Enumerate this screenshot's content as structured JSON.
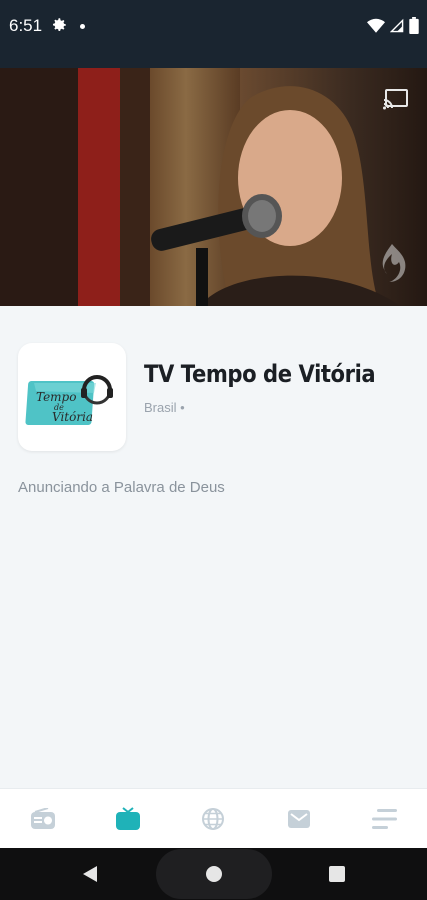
{
  "status_bar": {
    "time": "6:51",
    "icons": [
      "gear-icon",
      "notification-dot-icon",
      "wifi-icon",
      "signal-icon",
      "battery-icon"
    ]
  },
  "video": {
    "cast_icon": "cast-icon",
    "watermark_icon": "flame-watermark-icon"
  },
  "channel": {
    "logo_icon": "tempo-de-vitoria-logo",
    "logo_text_line1": "Tempo",
    "logo_text_line2": "de",
    "logo_text_line3": "Vitória",
    "title": "TV Tempo de Vitória",
    "meta": "Brasil •",
    "description": "Anunciando a Palavra de Deus"
  },
  "bottom_nav": {
    "items": [
      {
        "icon": "radio-icon",
        "active": false
      },
      {
        "icon": "tv-icon",
        "active": true
      },
      {
        "icon": "globe-icon",
        "active": false
      },
      {
        "icon": "mail-icon",
        "active": false
      },
      {
        "icon": "menu-icon",
        "active": false
      }
    ],
    "active_color": "#1fb2b8",
    "inactive_color": "#c5d0d8"
  },
  "system_nav": {
    "icons": [
      "back-icon",
      "home-icon",
      "recents-icon"
    ]
  }
}
